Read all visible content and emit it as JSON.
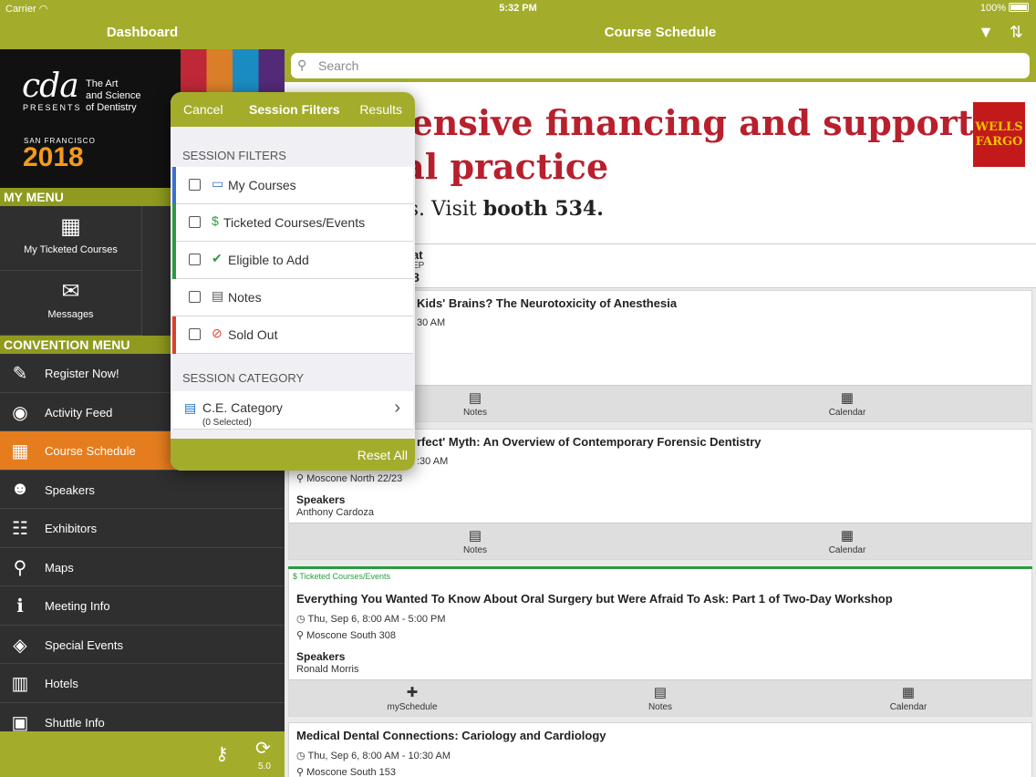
{
  "status_bar": {
    "carrier": "Carrier",
    "time": "5:32 PM",
    "battery": "100%"
  },
  "header": {
    "dashboard_title": "Dashboard",
    "main_title": "Course Schedule"
  },
  "sidebar": {
    "logo": {
      "brand": "cda",
      "presents": "PRESENTS",
      "tagline1": "The Art",
      "tagline2": "and Science",
      "tagline3": "of Dentistry",
      "city": "SAN FRANCISCO",
      "year": "2018"
    },
    "my_menu_label": "MY MENU",
    "my_menu": [
      {
        "label": "My Ticketed Courses",
        "icon": "calendar-icon"
      },
      {
        "label": "Messages",
        "icon": "envelope-icon"
      }
    ],
    "convention_menu_label": "CONVENTION MENU",
    "convention_menu": [
      {
        "label": "Register Now!",
        "icon": "edit-icon"
      },
      {
        "label": "Activity Feed",
        "icon": "rss-icon"
      },
      {
        "label": "Course Schedule",
        "icon": "calendar-icon",
        "active": true
      },
      {
        "label": "Speakers",
        "icon": "presenter-icon"
      },
      {
        "label": "Exhibitors",
        "icon": "group-icon"
      },
      {
        "label": "Maps",
        "icon": "map-marker-icon"
      },
      {
        "label": "Meeting Info",
        "icon": "info-icon"
      },
      {
        "label": "Special Events",
        "icon": "ticket-icon"
      },
      {
        "label": "Hotels",
        "icon": "building-icon"
      },
      {
        "label": "Shuttle Info",
        "icon": "bus-icon"
      }
    ],
    "footer": {
      "version": "5.0"
    }
  },
  "search": {
    "placeholder": "Search"
  },
  "ad": {
    "line1": "mprehensive financing and support",
    "line2": "r dental practice",
    "line3_prefix": "ut your plans. Visit ",
    "line3_bold": "booth 534.",
    "logo_line1": "WELLS",
    "logo_line2": "FARGO"
  },
  "date_strip": {
    "weekday": "at",
    "month": "EP",
    "day": "8"
  },
  "sessions": [
    {
      "title": "Kids' Brains? The Neurotoxicity of Anesthesia",
      "time": "30 AM",
      "notes_label": "Notes",
      "calendar_label": "Calendar"
    },
    {
      "title": "rfect' Myth: An Overview of Contemporary Forensic Dentistry",
      "time": ":30 AM",
      "location": "Moscone North 22/23",
      "speakers_label": "Speakers",
      "speaker": "Anthony Cardoza",
      "notes_label": "Notes",
      "calendar_label": "Calendar"
    },
    {
      "tag": "Ticketed Courses/Events",
      "title": "Everything You Wanted To Know About Oral Surgery but Were Afraid To Ask: Part 1 of Two-Day Workshop",
      "time": "Thu, Sep 6, 8:00 AM - 5:00 PM",
      "location": "Moscone South 308",
      "speakers_label": "Speakers",
      "speaker": "Ronald Morris",
      "myschedule_label": "mySchedule",
      "notes_label": "Notes",
      "calendar_label": "Calendar"
    },
    {
      "title": "Medical Dental Connections: Cariology and Cardiology",
      "time": "Thu, Sep 6, 8:00 AM - 10:30 AM",
      "location": "Moscone South 153"
    }
  ],
  "filters_popover": {
    "cancel": "Cancel",
    "title": "Session Filters",
    "results": "Results",
    "section_filters": "SESSION FILTERS",
    "filters": [
      {
        "label": "My Courses",
        "icon": "briefcase-icon",
        "accent": "#3b6fd1"
      },
      {
        "label": "Ticketed Courses/Events",
        "icon": "dollar-icon",
        "accent": "#2a9c3f"
      },
      {
        "label": "Eligible to Add",
        "icon": "check-icon",
        "accent": "#2a9c3f"
      },
      {
        "label": "Notes",
        "icon": "document-icon",
        "accent": ""
      },
      {
        "label": "Sold Out",
        "icon": "ban-icon",
        "accent": "#e0402a"
      }
    ],
    "section_category": "SESSION CATEGORY",
    "category": {
      "label": "C.E. Category",
      "sub": "(0 Selected)"
    },
    "reset": "Reset All"
  },
  "colors": {
    "brand_green": "#a3ad2b",
    "active_orange": "#e57d1f",
    "sidebar_dark": "#2f2f2f",
    "ticketed_green": "#2a9c3f"
  }
}
